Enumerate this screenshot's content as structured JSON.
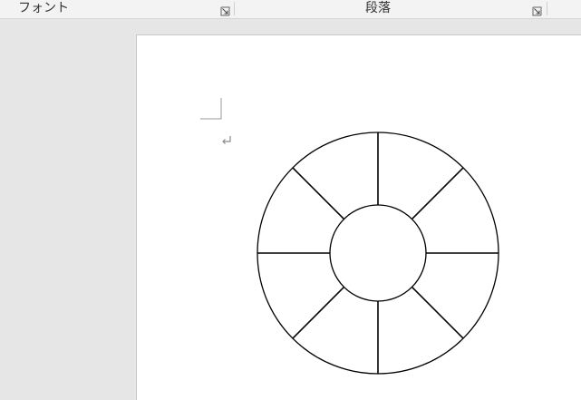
{
  "ribbon": {
    "font_group_label": "フォント",
    "paragraph_group_label": "段落"
  },
  "icons": {
    "font_launcher": "dialog-launcher-icon",
    "paragraph_launcher": "dialog-launcher-icon",
    "paragraph_mark": "paragraph-return-icon",
    "margin_mark": "text-boundary-corner-icon"
  },
  "colors": {
    "ribbon_bg": "#f3f3f3",
    "workspace_bg": "#e6e6e6",
    "page_bg": "#ffffff",
    "shape_stroke": "#000000"
  },
  "shape": {
    "type": "ring-divided",
    "segments": 8
  }
}
